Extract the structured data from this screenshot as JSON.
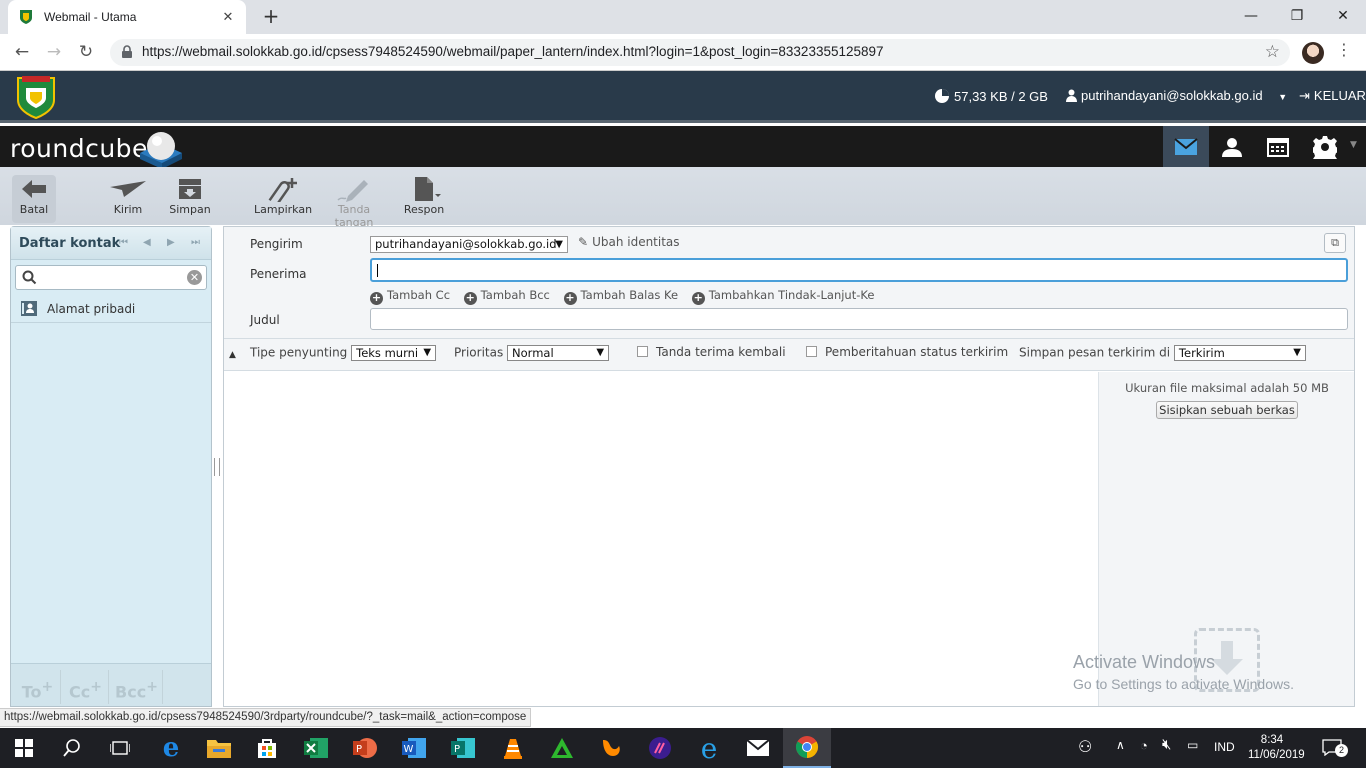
{
  "browser": {
    "tab_title": "Webmail - Utama",
    "url": "https://webmail.solokkab.go.id/cpsess7948524590/webmail/paper_lantern/index.html?login=1&post_login=83323355125897"
  },
  "cpanel": {
    "quota": "57,33 KB / 2 GB",
    "user": "putrihandayani@solokkab.go.id",
    "logout": "KELUAR"
  },
  "roundcube": {
    "logo_text": "roundcube"
  },
  "toolbar": {
    "cancel": "Batal",
    "send": "Kirim",
    "save": "Simpan",
    "attach": "Lampirkan",
    "signature": "Tanda tangan",
    "respond": "Respon"
  },
  "contacts": {
    "title": "Daftar kontak",
    "search_placeholder": "",
    "address_book": "Alamat pribadi",
    "to": "To",
    "cc": "Cc",
    "bcc": "Bcc",
    "plus": "+"
  },
  "compose": {
    "sender_label": "Pengirim",
    "sender_value": "putrihandayani@solokkab.go.id",
    "change_identity": "Ubah identitas",
    "recipient_label": "Penerima",
    "recipient_value": "",
    "add_cc": "Tambah Cc",
    "add_bcc": "Tambah Bcc",
    "add_reply_to": "Tambah Balas Ke",
    "add_followup": "Tambahkan Tindak-Lanjut-Ke",
    "subject_label": "Judul",
    "subject_value": "",
    "editor_type_label": "Tipe penyunting",
    "editor_type_value": "Teks murni",
    "priority_label": "Prioritas",
    "priority_value": "Normal",
    "return_receipt": "Tanda terima kembali",
    "dsn": "Pemberitahuan status terkirim",
    "save_sent_label": "Simpan pesan terkirim di",
    "save_sent_value": "Terkirim",
    "max_file_size": "Ukuran file maksimal adalah 50 MB",
    "attach_button": "Sisipkan sebuah berkas"
  },
  "watermark": {
    "line1": "Activate Windows",
    "line2": "Go to Settings to activate Windows."
  },
  "status_url": "https://webmail.solokkab.go.id/cpsess7948524590/3rdparty/roundcube/?_task=mail&_action=compose",
  "taskbar": {
    "language": "IND",
    "time": "8:34",
    "date": "11/06/2019",
    "notifications": "2"
  },
  "colors": {
    "cpanel_bar": "#293a4a",
    "roundcube_bar": "#1a1a1a",
    "focus_blue": "#4a9fd9",
    "left_panel": "#d9ecf4"
  }
}
